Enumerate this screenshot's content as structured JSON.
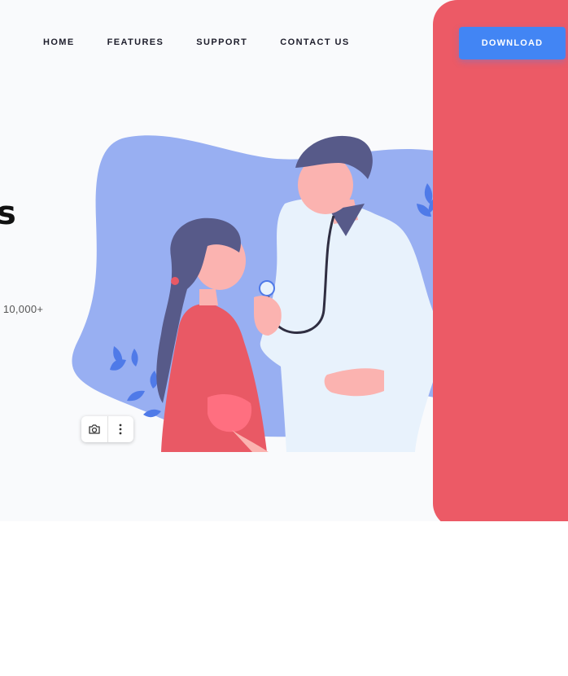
{
  "nav": {
    "items": [
      {
        "label": "HOME"
      },
      {
        "label": "FEATURES"
      },
      {
        "label": "SUPPORT"
      },
      {
        "label": "CONTACT US"
      }
    ],
    "cta_label": "DOWNLOAD"
  },
  "hero": {
    "headline_visible": "s",
    "stat_visible": ": 10,000+"
  },
  "illustration": {
    "icon": "doctor-patient-illustration",
    "colors": {
      "blob": "#98aff2",
      "leaf": "#4f7ae8",
      "hair": "#575a89",
      "skin": "#fbb3b0",
      "coat": "#e8f2fc",
      "shirt": "#e95965",
      "panel": "#ec5a66",
      "accent": "#4285f4"
    }
  },
  "image_toolbar": {
    "buttons": [
      {
        "icon": "camera-search-icon"
      },
      {
        "icon": "more-vertical-icon"
      }
    ]
  }
}
